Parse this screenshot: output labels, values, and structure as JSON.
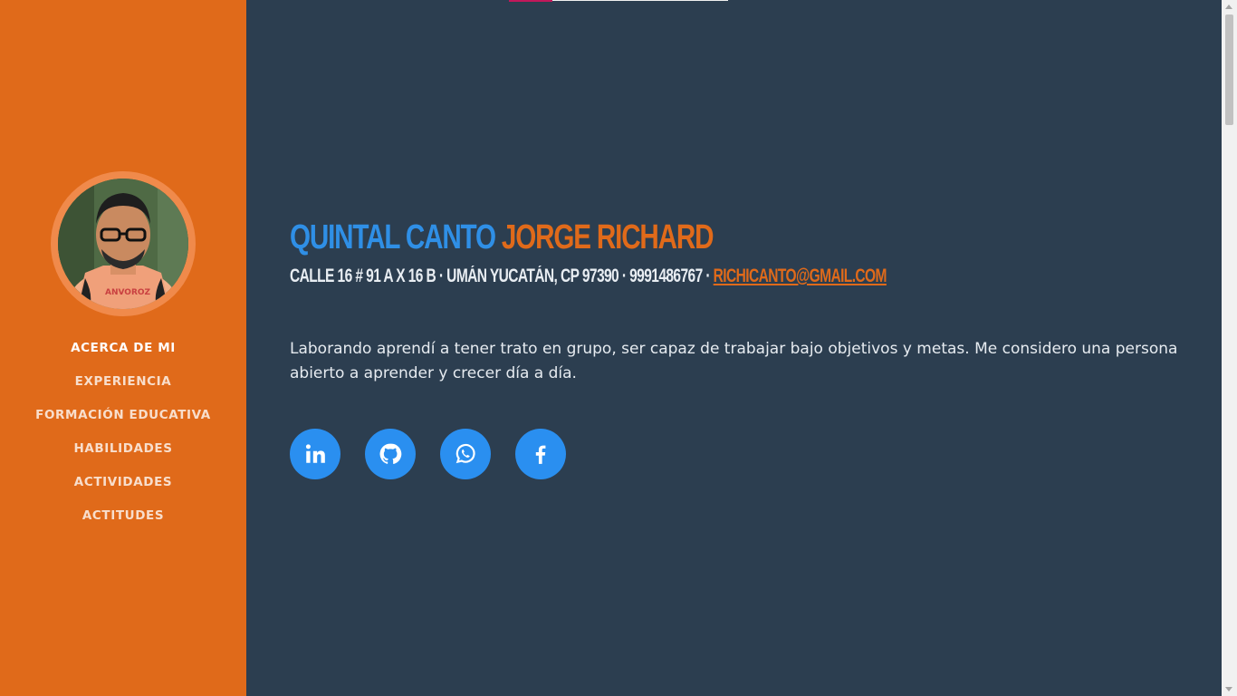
{
  "colors": {
    "sidebar_bg": "#e06a1a",
    "main_bg": "#2c3e50",
    "accent_blue": "#2f8fe6",
    "accent_orange": "#e06a1a",
    "social_bg": "#2a8ff0"
  },
  "sidebar": {
    "avatar_alt": "profile photo",
    "nav": [
      {
        "label": "ACERCA DE MI",
        "active": true
      },
      {
        "label": "EXPERIENCIA",
        "active": false
      },
      {
        "label": "FORMACIÓN EDUCATIVA",
        "active": false
      },
      {
        "label": "HABILIDADES",
        "active": false
      },
      {
        "label": "ACTIVIDADES",
        "active": false
      },
      {
        "label": "ACTITUDES",
        "active": false
      }
    ]
  },
  "about": {
    "first_name": "QUINTAL CANTO",
    "last_name": "JORGE RICHARD",
    "address": "CALLE 16 # 91 A X 16 B · UMÁN YUCATÁN, CP 97390 · 9991486767 · ",
    "email": "RICHICANTO@GMAIL.COM",
    "lead": "Laborando aprendí a tener trato en grupo, ser capaz de trabajar bajo objetivos y metas. Me considero una persona abierto a aprender y crecer día a día.",
    "social_icons": [
      "linkedin-icon",
      "github-icon",
      "whatsapp-icon",
      "facebook-icon"
    ]
  }
}
